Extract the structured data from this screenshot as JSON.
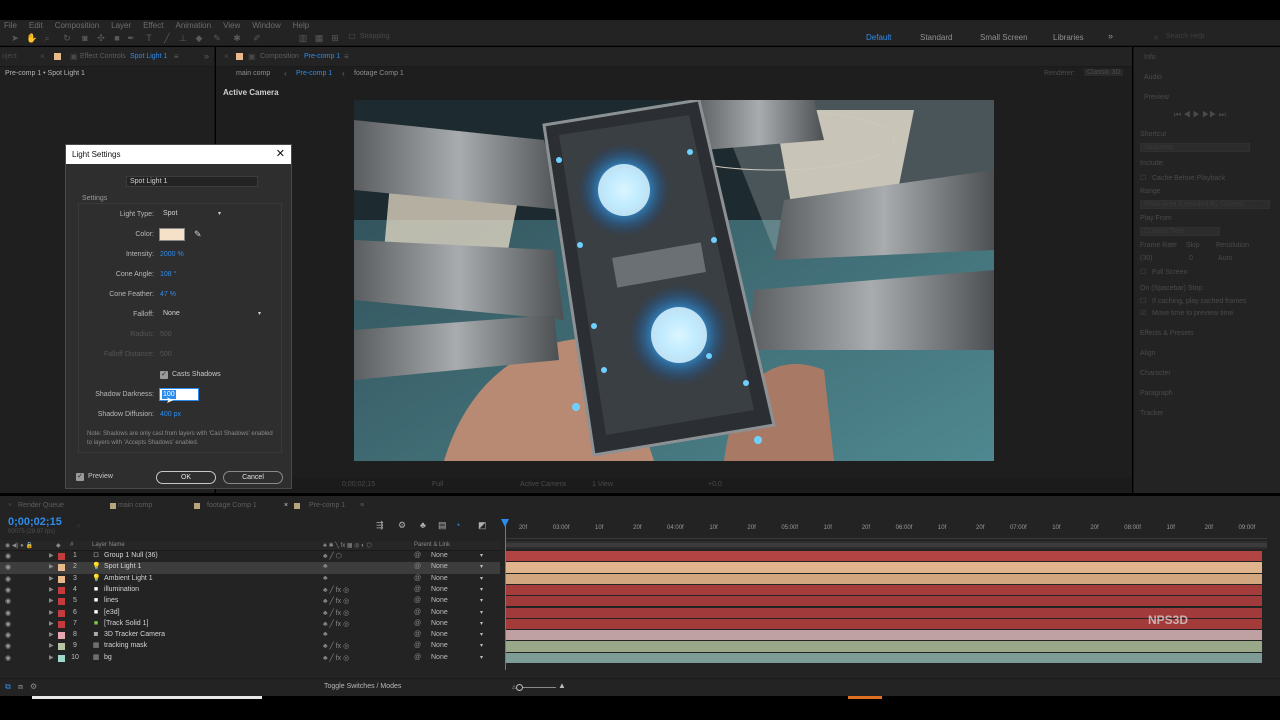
{
  "menu": [
    "File",
    "Edit",
    "Composition",
    "Layer",
    "Effect",
    "Animation",
    "View",
    "Window",
    "Help"
  ],
  "toolbar": {
    "snapping": "Snapping",
    "workspaces": [
      "Default",
      "Standard",
      "Small Screen",
      "Libraries"
    ],
    "search_placeholder": "Search Help"
  },
  "left_panel": {
    "tab_partial": "oject",
    "tab_effect_controls": "Effect Controls",
    "tab_layer": "Spot Light 1",
    "breadcrumb": "Pre-comp 1 • Spot Light 1"
  },
  "comp_panel": {
    "tab_label": "Composition",
    "tab_comp": "Pre-comp 1",
    "nav": [
      "main comp",
      "Pre-comp 1",
      "footage Comp 1"
    ],
    "renderer_label": "Renderer:",
    "renderer_value": "Classic 3D",
    "active_camera": "Active Camera",
    "viewer_bar": {
      "time": "0;00;02;15",
      "quality": "Full",
      "view": "Active Camera",
      "views": "1 View",
      "exposure": "+0.0"
    }
  },
  "right_panel": {
    "items": [
      "Info",
      "Audio",
      "Preview",
      "Shortcut",
      "Spacebar",
      "Include:",
      "Cache Before Playback",
      "Range",
      "Work Area Extended By Current...",
      "Play From",
      "Current Time",
      "Frame Rate",
      "Skip",
      "Resolution",
      "(30)",
      "0",
      "Auto",
      "Full Screen",
      "On (Spacebar) Stop:",
      "If caching, play cached frames",
      "Move time to preview time",
      "Effects & Presets",
      "Align",
      "Character",
      "Paragraph",
      "Tracker"
    ]
  },
  "dialog": {
    "title": "Light Settings",
    "name_label": "Name:",
    "name_value": "Spot Light 1",
    "settings_label": "Settings",
    "light_type_label": "Light Type:",
    "light_type_value": "Spot",
    "color_label": "Color:",
    "color_value": "#f5e0c8",
    "intensity_label": "Intensity:",
    "intensity_value": "2000 %",
    "cone_angle_label": "Cone Angle:",
    "cone_angle_value": "108 °",
    "cone_feather_label": "Cone Feather:",
    "cone_feather_value": "47 %",
    "falloff_label": "Falloff:",
    "falloff_value": "None",
    "radius_label": "Radius:",
    "radius_value": "500",
    "falloff_distance_label": "Falloff Distance:",
    "falloff_distance_value": "500",
    "casts_shadows_label": "Casts Shadows",
    "shadow_darkness_label": "Shadow Darkness:",
    "shadow_darkness_value": "100",
    "shadow_diffusion_label": "Shadow Diffusion:",
    "shadow_diffusion_value": "400 px",
    "note": "Note: Shadows are only cast from layers with 'Cast Shadows' enabled to layers with 'Accepts Shadows' enabled.",
    "preview_label": "Preview",
    "ok_label": "OK",
    "cancel_label": "Cancel"
  },
  "timeline": {
    "tabs": [
      "Render Queue",
      "main comp",
      "footage Comp 1",
      "Pre-comp 1"
    ],
    "timecode": "0;00;02;15",
    "timecode_sub": "00075 (29.97 fps)",
    "headers": {
      "num": "#",
      "layer_name": "Layer Name",
      "parent": "Parent & Link"
    },
    "ruler_ticks": [
      "20f",
      "03:00f",
      "10f",
      "20f",
      "04:00f",
      "10f",
      "20f",
      "05:00f",
      "10f",
      "20f",
      "06:00f",
      "10f",
      "20f",
      "07:00f",
      "10f",
      "20f",
      "08:00f",
      "10f",
      "20f",
      "09:00f"
    ],
    "layers": [
      {
        "num": "1",
        "name": "Group 1 Null (36)",
        "label_color": "#c43b3b",
        "icon": "null-icon",
        "parent": "None",
        "bar_color": "#b34444"
      },
      {
        "num": "2",
        "name": "Spot Light 1",
        "label_color": "#e8b98a",
        "icon": "light-icon",
        "parent": "None",
        "bar_color": "#e0b48c"
      },
      {
        "num": "3",
        "name": "Ambient Light 1",
        "label_color": "#e8b98a",
        "icon": "light-icon",
        "parent": "None",
        "bar_color": "#d2a67e"
      },
      {
        "num": "4",
        "name": "illumination",
        "label_color": "#c43b3b",
        "icon": "solid-icon",
        "parent": "None",
        "bar_color": "#a53c3c"
      },
      {
        "num": "5",
        "name": "lines",
        "label_color": "#c43b3b",
        "icon": "solid-icon",
        "parent": "None",
        "bar_color": "#a13a3a"
      },
      {
        "num": "6",
        "name": "[e3d]",
        "label_color": "#c43b3b",
        "icon": "solid-icon",
        "parent": "None",
        "bar_color": "#a13a3a"
      },
      {
        "num": "7",
        "name": "[Track Solid 1]",
        "label_color": "#c43b3b",
        "icon": "solid-green-icon",
        "parent": "None",
        "bar_color": "#a43b3b"
      },
      {
        "num": "8",
        "name": "3D Tracker Camera",
        "label_color": "#e6a7b0",
        "icon": "camera-icon",
        "parent": "None",
        "bar_color": "#bfa0a3"
      },
      {
        "num": "9",
        "name": "tracking mask",
        "label_color": "#b7c4a5",
        "icon": "footage-icon",
        "parent": "None",
        "bar_color": "#9aa88a"
      },
      {
        "num": "10",
        "name": "bg",
        "label_color": "#9ed6c9",
        "icon": "footage-icon",
        "parent": "None",
        "bar_color": "#7e9c96"
      }
    ],
    "toggle_label": "Toggle Switches / Modes"
  },
  "watermark": "NPS3D",
  "colors": {
    "accent": "#2d8ceb"
  }
}
